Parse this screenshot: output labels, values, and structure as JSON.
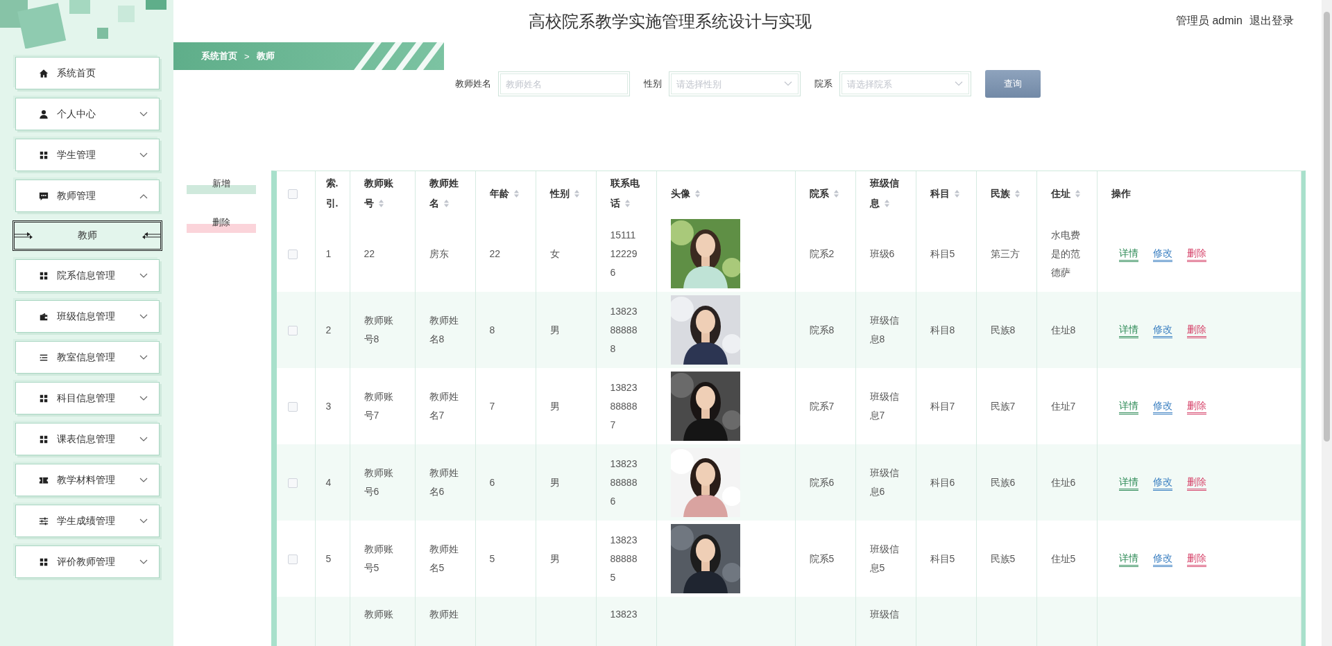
{
  "header": {
    "title": "高校院系教学实施管理系统设计与实现",
    "user": "管理员 admin",
    "logout": "退出登录"
  },
  "breadcrumb": {
    "items": [
      "系统首页",
      "教师"
    ],
    "separator": ">"
  },
  "sidebar": {
    "items": [
      {
        "label": "系统首页",
        "kind": "home"
      },
      {
        "label": "个人中心",
        "kind": "user",
        "expanded": false
      },
      {
        "label": "学生管理",
        "kind": "grid",
        "expanded": false
      },
      {
        "label": "教师管理",
        "kind": "chat",
        "expanded": true,
        "children": [
          {
            "label": "教师",
            "selected": true
          }
        ]
      },
      {
        "label": "院系信息管理",
        "kind": "grid",
        "expanded": false
      },
      {
        "label": "班级信息管理",
        "kind": "wallet",
        "expanded": false
      },
      {
        "label": "教室信息管理",
        "kind": "list",
        "expanded": false
      },
      {
        "label": "科目信息管理",
        "kind": "grid",
        "expanded": false
      },
      {
        "label": "课表信息管理",
        "kind": "grid",
        "expanded": false
      },
      {
        "label": "教学材料管理",
        "kind": "ticket",
        "expanded": false
      },
      {
        "label": "学生成绩管理",
        "kind": "sliders",
        "expanded": false
      },
      {
        "label": "评价教师管理",
        "kind": "grid",
        "expanded": false
      }
    ]
  },
  "search": {
    "fields": [
      {
        "label": "教师姓名",
        "placeholder": "教师姓名",
        "kind": "text"
      },
      {
        "label": "性别",
        "placeholder": "请选择性别",
        "kind": "select"
      },
      {
        "label": "院系",
        "placeholder": "请选择院系",
        "kind": "select"
      }
    ],
    "button": "查询"
  },
  "actions": [
    {
      "label": "新增",
      "kind": "add"
    },
    {
      "label": "删除",
      "kind": "delete"
    }
  ],
  "table": {
    "select_all": {
      "checked": false
    },
    "columns": [
      {
        "label": "索.引.",
        "sortable": false
      },
      {
        "label": "教师账号",
        "sortable": true
      },
      {
        "label": "教师姓名",
        "sortable": true
      },
      {
        "label": "年龄",
        "sortable": true
      },
      {
        "label": "性别",
        "sortable": true
      },
      {
        "label": "联系电话",
        "sortable": true
      },
      {
        "label": "头像",
        "sortable": true
      },
      {
        "label": "院系",
        "sortable": true
      },
      {
        "label": "班级信息",
        "sortable": true
      },
      {
        "label": "科目",
        "sortable": true
      },
      {
        "label": "民族",
        "sortable": true
      },
      {
        "label": "住址",
        "sortable": true
      },
      {
        "label": "操作",
        "sortable": false
      }
    ],
    "rows": [
      {
        "checked": false,
        "index": "1",
        "account": "22",
        "name": "房东",
        "age": "22",
        "gender": "女",
        "phone": "15111122296",
        "department": "院系2",
        "class": "班级6",
        "subject": "科目5",
        "ethnicity": "第三方",
        "address": "水电费是的范德萨",
        "actions": [
          {
            "label": "详情",
            "kind": "detail"
          },
          {
            "label": "修改",
            "kind": "edit"
          },
          {
            "label": "删除",
            "kind": "delete"
          }
        ]
      },
      {
        "checked": false,
        "index": "2",
        "account": "教师账号8",
        "name": "教师姓名8",
        "age": "8",
        "gender": "男",
        "phone": "13823888888",
        "department": "院系8",
        "class": "班级信息8",
        "subject": "科目8",
        "ethnicity": "民族8",
        "address": "住址8",
        "actions": [
          {
            "label": "详情",
            "kind": "detail"
          },
          {
            "label": "修改",
            "kind": "edit"
          },
          {
            "label": "删除",
            "kind": "delete"
          }
        ]
      },
      {
        "checked": false,
        "index": "3",
        "account": "教师账号7",
        "name": "教师姓名7",
        "age": "7",
        "gender": "男",
        "phone": "13823888887",
        "department": "院系7",
        "class": "班级信息7",
        "subject": "科目7",
        "ethnicity": "民族7",
        "address": "住址7",
        "actions": [
          {
            "label": "详情",
            "kind": "detail"
          },
          {
            "label": "修改",
            "kind": "edit"
          },
          {
            "label": "删除",
            "kind": "delete"
          }
        ]
      },
      {
        "checked": false,
        "index": "4",
        "account": "教师账号6",
        "name": "教师姓名6",
        "age": "6",
        "gender": "男",
        "phone": "13823888886",
        "department": "院系6",
        "class": "班级信息6",
        "subject": "科目6",
        "ethnicity": "民族6",
        "address": "住址6",
        "actions": [
          {
            "label": "详情",
            "kind": "detail"
          },
          {
            "label": "修改",
            "kind": "edit"
          },
          {
            "label": "删除",
            "kind": "delete"
          }
        ]
      },
      {
        "checked": false,
        "index": "5",
        "account": "教师账号5",
        "name": "教师姓名5",
        "age": "5",
        "gender": "男",
        "phone": "13823888885",
        "department": "院系5",
        "class": "班级信息5",
        "subject": "科目5",
        "ethnicity": "民族5",
        "address": "住址5",
        "actions": [
          {
            "label": "详情",
            "kind": "detail"
          },
          {
            "label": "修改",
            "kind": "edit"
          },
          {
            "label": "删除",
            "kind": "delete"
          }
        ]
      },
      {
        "account": "教师账",
        "name": "教师姓",
        "phone": "13823",
        "class": "班级信"
      }
    ]
  }
}
